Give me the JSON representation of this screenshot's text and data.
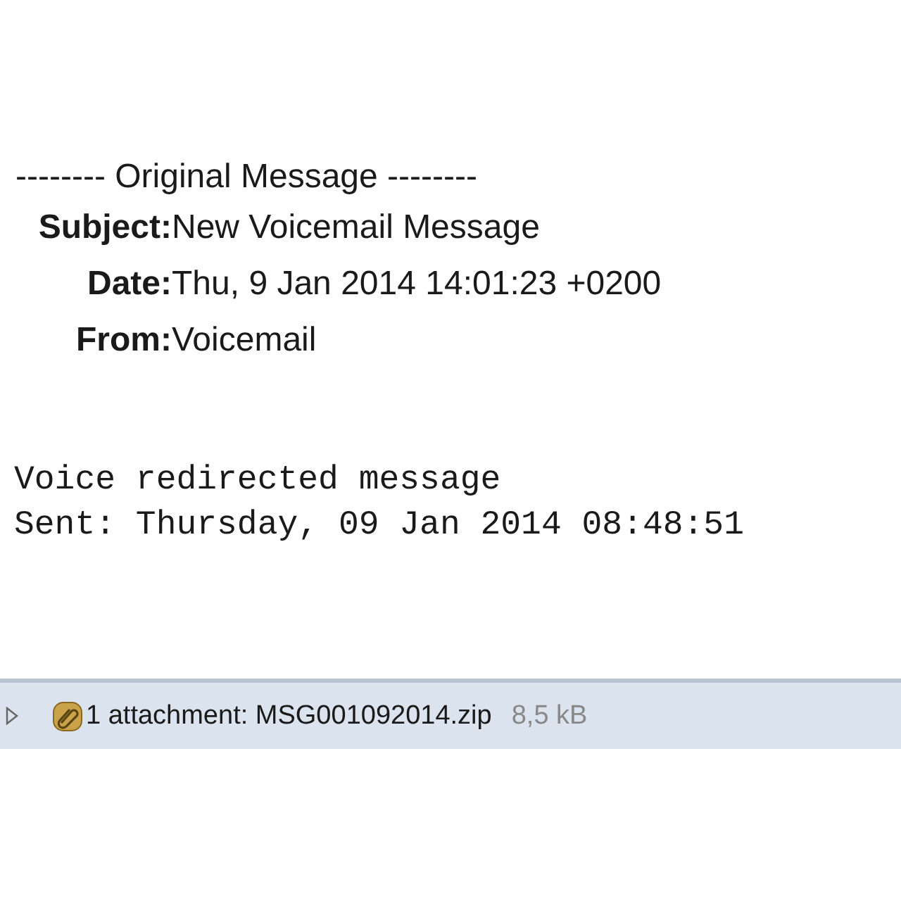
{
  "separator": "-------- Original Message --------",
  "headers": [
    {
      "label": "Subject:",
      "value": "New Voicemail Message"
    },
    {
      "label": "Date:",
      "value": "Thu, 9 Jan 2014 14:01:23 +0200"
    },
    {
      "label": "From:",
      "value": "Voicemail"
    }
  ],
  "body": [
    "Voice redirected message",
    "Sent: Thursday, 09 Jan 2014 08:48:51"
  ],
  "attachments": {
    "expanded": false,
    "summary": "1 attachment: MSG001092014.zip",
    "size": "8,5 kB"
  }
}
